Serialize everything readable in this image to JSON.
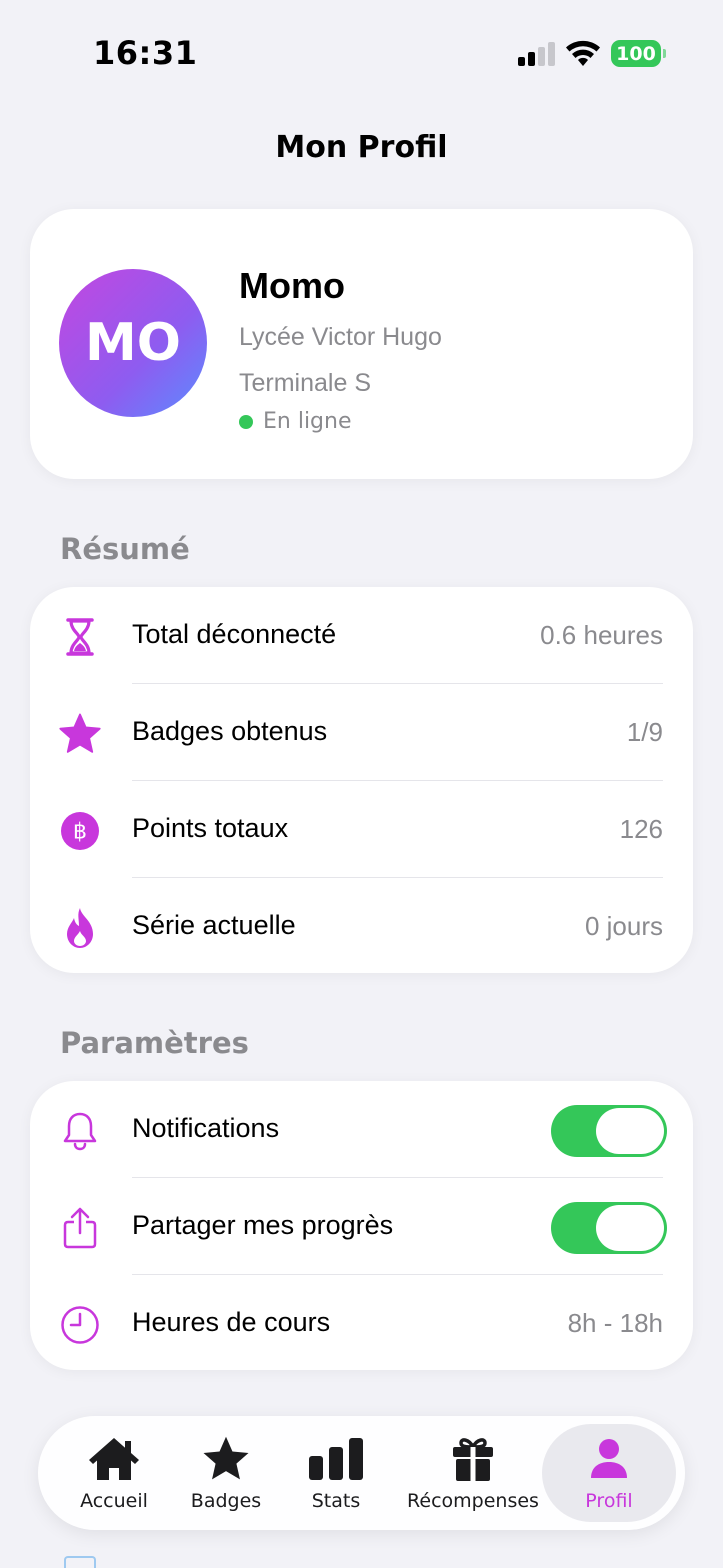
{
  "status_bar": {
    "time": "16:31",
    "battery": "100"
  },
  "page": {
    "title": "Mon Profil"
  },
  "profile": {
    "initials": "MO",
    "name": "Momo",
    "school": "Lycée Victor Hugo",
    "class_level": "Terminale S",
    "status": "En ligne"
  },
  "summary": {
    "header": "Résumé",
    "items": [
      {
        "icon": "hourglass-icon",
        "label": "Total déconnecté",
        "value": "0.6 heures"
      },
      {
        "icon": "star-icon",
        "label": "Badges obtenus",
        "value": "1/9"
      },
      {
        "icon": "bitcoin-icon",
        "label": "Points totaux",
        "value": "126"
      },
      {
        "icon": "flame-icon",
        "label": "Série actuelle",
        "value": "0 jours"
      }
    ]
  },
  "settings": {
    "header": "Paramètres",
    "items": [
      {
        "icon": "bell-icon",
        "label": "Notifications",
        "toggle_on": true
      },
      {
        "icon": "share-icon",
        "label": "Partager mes progrès",
        "toggle_on": true
      },
      {
        "icon": "clock-icon",
        "label": "Heures de cours",
        "value": "8h - 18h"
      }
    ]
  },
  "tab_bar": {
    "tabs": [
      {
        "icon": "house-icon",
        "label": "Accueil",
        "active": false
      },
      {
        "icon": "star-icon",
        "label": "Badges",
        "active": false
      },
      {
        "icon": "chart-bar-icon",
        "label": "Stats",
        "active": false
      },
      {
        "icon": "gift-icon",
        "label": "Récompenses",
        "active": false
      },
      {
        "icon": "person-icon",
        "label": "Profil",
        "active": true
      }
    ]
  },
  "colors": {
    "accent": "#c837dc",
    "toggle_on": "#34c759",
    "online": "#34c759",
    "secondary_text": "#8a8a8e",
    "background": "#f2f2f7"
  }
}
